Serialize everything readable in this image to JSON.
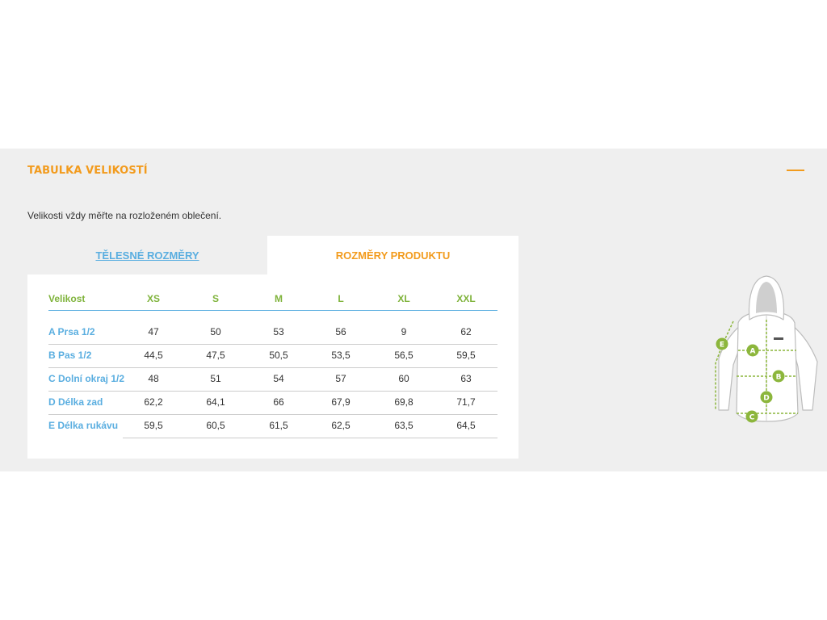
{
  "section": {
    "title": "TABULKA VELIKOSTÍ",
    "intro": "Velikosti vždy měřte na rozloženém oblečení."
  },
  "tabs": [
    {
      "label": "TĚLESNÉ ROZMĚRY",
      "active": false
    },
    {
      "label": "ROZMĚRY PRODUKTU",
      "active": true
    }
  ],
  "table": {
    "header": [
      "Velikost",
      "XS",
      "S",
      "M",
      "L",
      "XL",
      "XXL"
    ],
    "rows": [
      {
        "label": "A Prsa 1/2",
        "values": [
          "47",
          "50",
          "53",
          "56",
          "9",
          "62"
        ]
      },
      {
        "label": "B Pas 1/2",
        "values": [
          "44,5",
          "47,5",
          "50,5",
          "53,5",
          "56,5",
          "59,5"
        ]
      },
      {
        "label": "C Dolní okraj 1/2",
        "values": [
          "48",
          "51",
          "54",
          "57",
          "60",
          "63"
        ]
      },
      {
        "label": "D Délka zad",
        "values": [
          "62,2",
          "64,1",
          "66",
          "67,9",
          "69,8",
          "71,7"
        ]
      },
      {
        "label": "E Délka rukávu",
        "values": [
          "59,5",
          "60,5",
          "61,5",
          "62,5",
          "63,5",
          "64,5"
        ]
      }
    ]
  },
  "diagram": {
    "markers": [
      "A",
      "B",
      "C",
      "D",
      "E"
    ],
    "accent": "#8cb63c",
    "icon": "jacket-measurement-diagram"
  },
  "colors": {
    "orange": "#f29b1d",
    "blue": "#5aaee0",
    "green": "#7fb33b",
    "panel": "#efefef"
  }
}
